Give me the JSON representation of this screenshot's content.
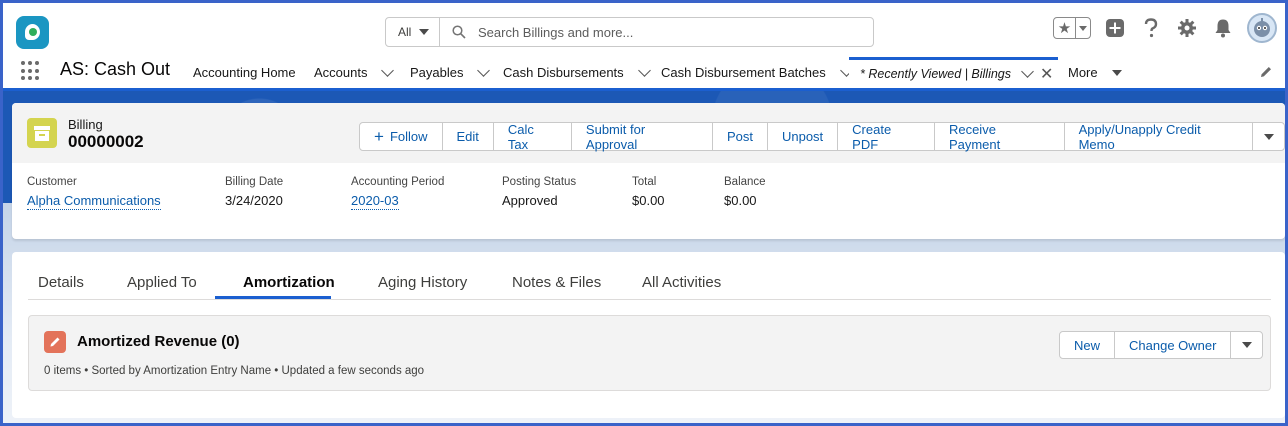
{
  "header": {
    "search_scope": "All",
    "search_placeholder": "Search Billings and more..."
  },
  "nav": {
    "app_name": "AS: Cash Out",
    "items": [
      {
        "label": "Accounting Home"
      },
      {
        "label": "Accounts"
      },
      {
        "label": "Payables"
      },
      {
        "label": "Cash Disbursements"
      },
      {
        "label": "Cash Disbursement Batches"
      }
    ],
    "active_tab": "* Recently Viewed | Billings",
    "more": "More"
  },
  "record": {
    "type": "Billing",
    "name": "00000002",
    "actions": {
      "follow": "Follow",
      "edit": "Edit",
      "calc_tax": "Calc Tax",
      "submit": "Submit for Approval",
      "post": "Post",
      "unpost": "Unpost",
      "create_pdf": "Create PDF",
      "receive_payment": "Receive Payment",
      "apply_credit": "Apply/Unapply Credit Memo"
    },
    "fields": [
      {
        "label": "Customer",
        "value": "Alpha Communications"
      },
      {
        "label": "Billing Date",
        "value": "3/24/2020"
      },
      {
        "label": "Accounting Period",
        "value": "2020-03"
      },
      {
        "label": "Posting Status",
        "value": "Approved"
      },
      {
        "label": "Total",
        "value": "$0.00"
      },
      {
        "label": "Balance",
        "value": "$0.00"
      }
    ]
  },
  "tabs": [
    {
      "label": "Details"
    },
    {
      "label": "Applied To"
    },
    {
      "label": "Amortization"
    },
    {
      "label": "Aging History"
    },
    {
      "label": "Notes & Files"
    },
    {
      "label": "All Activities"
    }
  ],
  "related": {
    "title": "Amortized Revenue (0)",
    "subtitle": "0 items • Sorted by Amortization Entry Name • Updated a few seconds ago",
    "new_label": "New",
    "change_owner_label": "Change Owner"
  },
  "colors": {
    "brand_blue": "#1b5fd0",
    "link": "#0b5cab",
    "record_icon": "#d4d44f",
    "related_icon": "#e3735a"
  }
}
